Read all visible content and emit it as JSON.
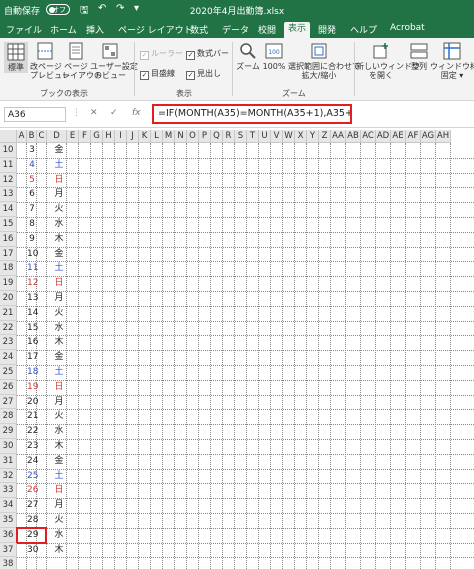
{
  "titlebar": {
    "autosave": "自動保存",
    "toggle": "オフ",
    "window_title": "2020年4月出勤簿.xlsx"
  },
  "tabs": [
    "ファイル",
    "ホーム",
    "挿入",
    "ページ レイアウト",
    "数式",
    "データ",
    "校閲",
    "表示",
    "開発",
    "ヘルプ",
    "Acrobat"
  ],
  "active_tab": "表示",
  "ribbon": {
    "book_view": {
      "normal": "標準",
      "page_break": "改ページ\nプレビュー",
      "page_layout": "ページ\nレイアウト",
      "custom": "ユーザー設定\nのビュー",
      "label": "ブックの表示"
    },
    "show": {
      "ruler": "ルーラー",
      "formula_bar": "数式バー",
      "gridlines": "目盛線",
      "headings": "見出し",
      "label": "表示"
    },
    "zoom": {
      "zoom": "ズーム",
      "zoom100": "100%",
      "zoom100_icon": "100",
      "fit_selection": "選択範囲に合わせて\n拡大/縮小",
      "label": "ズーム"
    },
    "window": {
      "new_window": "新しいウィンドウ\nを開く",
      "arrange": "整列",
      "freeze": "ウィンドウ枠の\n固定 ▾"
    }
  },
  "formula_bar": {
    "name_box": "A36",
    "formula": "=IF(MONTH(A35)=MONTH(A35+1),A35+1,\"\")"
  },
  "columns": [
    "A",
    "B",
    "C",
    "D",
    "E",
    "F",
    "G",
    "H",
    "I",
    "J",
    "K",
    "L",
    "M",
    "N",
    "O",
    "P",
    "Q",
    "R",
    "S",
    "T",
    "U",
    "V",
    "W",
    "X",
    "Y",
    "Z",
    "AA",
    "AB",
    "AC",
    "AD",
    "AE",
    "AF",
    "AG",
    "AH"
  ],
  "rows": [
    {
      "row": "10",
      "day": "3",
      "dow": "金",
      "color": ""
    },
    {
      "row": "11",
      "day": "4",
      "dow": "土",
      "color": "blue"
    },
    {
      "row": "12",
      "day": "5",
      "dow": "日",
      "color": "red"
    },
    {
      "row": "13",
      "day": "6",
      "dow": "月",
      "color": ""
    },
    {
      "row": "14",
      "day": "7",
      "dow": "火",
      "color": ""
    },
    {
      "row": "15",
      "day": "8",
      "dow": "水",
      "color": ""
    },
    {
      "row": "16",
      "day": "9",
      "dow": "木",
      "color": ""
    },
    {
      "row": "17",
      "day": "10",
      "dow": "金",
      "color": ""
    },
    {
      "row": "18",
      "day": "11",
      "dow": "土",
      "color": "blue"
    },
    {
      "row": "19",
      "day": "12",
      "dow": "日",
      "color": "red"
    },
    {
      "row": "20",
      "day": "13",
      "dow": "月",
      "color": ""
    },
    {
      "row": "21",
      "day": "14",
      "dow": "火",
      "color": ""
    },
    {
      "row": "22",
      "day": "15",
      "dow": "水",
      "color": ""
    },
    {
      "row": "23",
      "day": "16",
      "dow": "木",
      "color": ""
    },
    {
      "row": "24",
      "day": "17",
      "dow": "金",
      "color": ""
    },
    {
      "row": "25",
      "day": "18",
      "dow": "土",
      "color": "blue"
    },
    {
      "row": "26",
      "day": "19",
      "dow": "日",
      "color": "red"
    },
    {
      "row": "27",
      "day": "20",
      "dow": "月",
      "color": ""
    },
    {
      "row": "28",
      "day": "21",
      "dow": "火",
      "color": ""
    },
    {
      "row": "29",
      "day": "22",
      "dow": "水",
      "color": ""
    },
    {
      "row": "30",
      "day": "23",
      "dow": "木",
      "color": ""
    },
    {
      "row": "31",
      "day": "24",
      "dow": "金",
      "color": ""
    },
    {
      "row": "32",
      "day": "25",
      "dow": "土",
      "color": "blue"
    },
    {
      "row": "33",
      "day": "26",
      "dow": "日",
      "color": "red"
    },
    {
      "row": "34",
      "day": "27",
      "dow": "月",
      "color": ""
    },
    {
      "row": "35",
      "day": "28",
      "dow": "火",
      "color": ""
    },
    {
      "row": "36",
      "day": "29",
      "dow": "水",
      "color": ""
    },
    {
      "row": "37",
      "day": "30",
      "dow": "木",
      "color": ""
    },
    {
      "row": "38",
      "day": "",
      "dow": "",
      "color": ""
    }
  ],
  "colors": {
    "excel_green": "#217346",
    "weekend_blue": "#2b4fd1",
    "sunday_red": "#d83232",
    "highlight_red": "#e02020"
  }
}
